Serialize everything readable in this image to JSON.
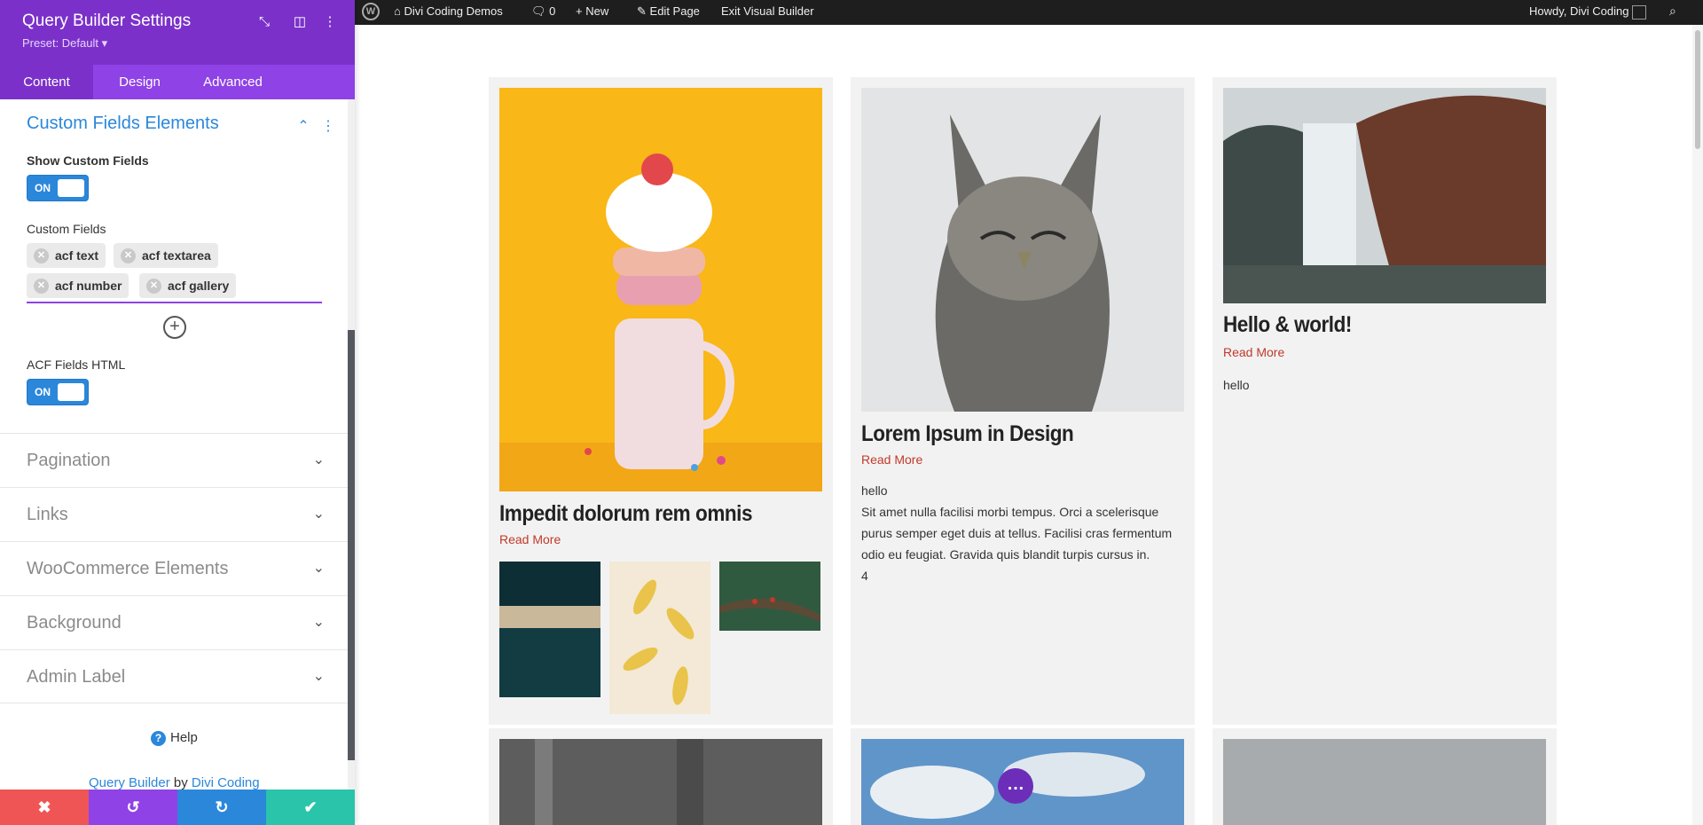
{
  "panel": {
    "title": "Query Builder Settings",
    "preset": "Preset: Default ▾",
    "tabs": [
      "Content",
      "Design",
      "Advanced"
    ],
    "section": {
      "title": "Custom Fields Elements",
      "show_custom_fields_label": "Show Custom Fields",
      "toggle_on": "ON",
      "custom_fields_label": "Custom Fields",
      "chips": [
        "acf text",
        "acf textarea",
        "acf number",
        "acf gallery"
      ],
      "acf_html_label": "ACF Fields HTML"
    },
    "collapsed_sections": [
      "Pagination",
      "Links",
      "WooCommerce Elements",
      "Background",
      "Admin Label"
    ],
    "help": "Help",
    "credit": {
      "product": "Query Builder",
      "by": "by",
      "author": "Divi Coding"
    }
  },
  "adminbar": {
    "site": "Divi Coding Demos",
    "comments": "0",
    "new": "New",
    "edit_page": "Edit Page",
    "exit_vb": "Exit Visual Builder",
    "howdy": "Howdy, Divi Coding"
  },
  "cards": [
    {
      "title": "Impedit dolorum rem omnis",
      "readmore": "Read More"
    },
    {
      "title": "Lorem Ipsum in Design",
      "readmore": "Read More",
      "text1": "hello",
      "text2": "Sit amet nulla facilisi morbi tempus. Orci a scelerisque purus semper eget duis at tellus. Facilisi cras fermentum odio eu feugiat. Gravida quis blandit turpis cursus in.",
      "text3": "4"
    },
    {
      "title": "Hello & world!",
      "readmore": "Read More",
      "text1": "hello"
    }
  ],
  "colors": {
    "accent": "#7b31c9",
    "primary": "#2b87da",
    "cancel": "#ef5555",
    "undo": "#8f42e6",
    "redo": "#2b87da",
    "save": "#29c4a9",
    "link": "#c0392b"
  },
  "icons": {
    "fab": "more-horizontal-icon"
  }
}
